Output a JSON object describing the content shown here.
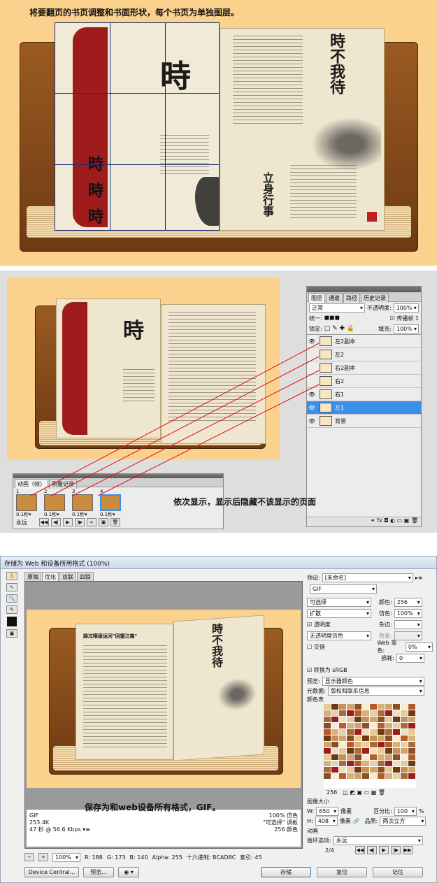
{
  "section1": {
    "caption": "将要翻页的书页调整和书面形状，每个书页为单独图层。",
    "big_char": "時",
    "right_title": "時不我待",
    "right_sig": "立身行事",
    "left_small": "時 時 時"
  },
  "section2": {
    "book_char": "時",
    "layers_panel": {
      "tabs": [
        "图层",
        "通道",
        "路径",
        "历史记录"
      ],
      "blend_mode": "正常",
      "opacity_label": "不透明度:",
      "opacity_value": "100%",
      "unify_label": "统一:",
      "propagate_label": "传播帧 1",
      "lock_label": "锁定:",
      "fill_label": "填充:",
      "fill_value": "100%",
      "layers": [
        {
          "name": "左2副本",
          "visible": true,
          "selected": false
        },
        {
          "name": "左2",
          "visible": false,
          "selected": false
        },
        {
          "name": "右2副本",
          "visible": false,
          "selected": false
        },
        {
          "name": "右2",
          "visible": false,
          "selected": false
        },
        {
          "name": "右1",
          "visible": true,
          "selected": false
        },
        {
          "name": "左1",
          "visible": true,
          "selected": true
        },
        {
          "name": "背景",
          "visible": true,
          "selected": false
        }
      ]
    },
    "animation_panel": {
      "tabs": [
        "动画（帧）",
        "测量记录"
      ],
      "frames": [
        {
          "num": "1",
          "delay": "0.1秒▾"
        },
        {
          "num": "2",
          "delay": "0.1秒▾"
        },
        {
          "num": "3",
          "delay": "0.1秒▾"
        },
        {
          "num": "4",
          "delay": "0.1秒▾"
        }
      ],
      "loop": "永远"
    },
    "caption": "依次显示，显示后隐藏不该显示的页面"
  },
  "section3": {
    "window_title": "存储为 Web 和设备所用格式 (100%)",
    "view_tabs": [
      "原稿",
      "优化",
      "双联",
      "四联"
    ],
    "preview_title": "路过隋唐运河\"回望江南\"",
    "preview_char": "時不我待",
    "caption": "保存为和web设备所有格式，GIF。",
    "info_left": [
      "GIF",
      "253.4K",
      "47 秒 @ 56.6 Kbps ▾≡"
    ],
    "info_right": [
      "100% 仿色",
      "\"可选择\" 调板",
      "256 颜色"
    ],
    "status": {
      "zoom": "100%",
      "r": "R: 188",
      "g": "G: 173",
      "b": "B: 140",
      "alpha": "Alpha: 255",
      "hex": "十六进制: BCAD8C",
      "index": "索引: 45"
    },
    "buttons": {
      "device": "Device Central...",
      "preview": "预览...",
      "save": "存储",
      "reset": "复位",
      "remember": "记住"
    },
    "settings": {
      "preset_label": "预设:",
      "preset_value": "[未命名]",
      "format": "GIF",
      "reduction": "可选择",
      "colors_label": "颜色:",
      "colors_value": "256",
      "dither": "扩散",
      "dither_label": "仿色:",
      "dither_value": "100%",
      "transparency": "透明度",
      "matte_label": "杂边:",
      "trans_dither": "无透明度仿色",
      "amount_label": "数量:",
      "interlaced": "交错",
      "websnap_label": "Web 靠色:",
      "websnap_value": "0%",
      "lossy_label": "损耗:",
      "lossy_value": "0",
      "convert_srgb": "转换为 sRGB",
      "preview_label": "预览:",
      "preview_value": "显示器颜色",
      "metadata_label": "元数据:",
      "metadata_value": "版权和联系信息",
      "color_table_label": "颜色表",
      "color_count": "256",
      "image_size_label": "图像大小",
      "w_label": "W:",
      "w_value": "650",
      "h_label": "H:",
      "h_value": "408",
      "px": "像素",
      "percent_label": "百分比:",
      "percent_value": "100",
      "pct": "%",
      "quality_label": "品质:",
      "quality_value": "两次立方",
      "animation_label": "动画",
      "loop_label": "循环选项:",
      "loop_value": "永远",
      "frame_counter": "2/4"
    }
  },
  "colors": {
    "bg_yellow": "#fbd18e",
    "selection_blue": "#3a8fe6",
    "book_red": "#9e1c1c"
  }
}
